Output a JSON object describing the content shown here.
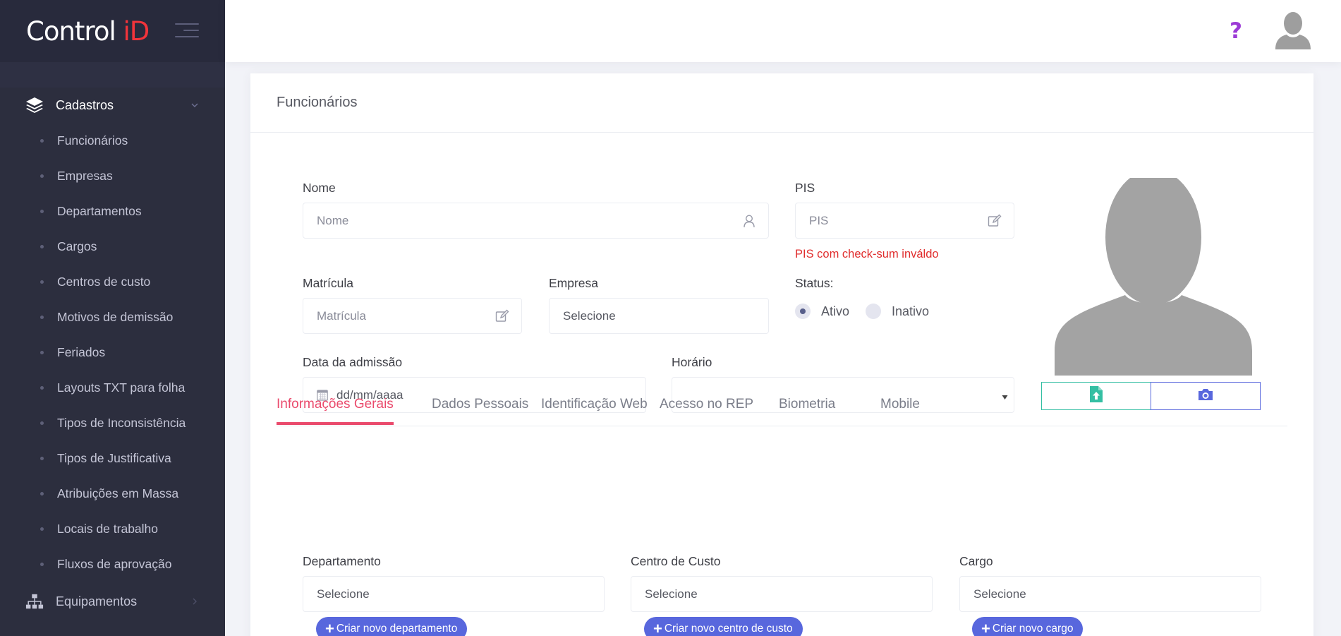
{
  "brand": {
    "name_part1": "Control ",
    "name_part2": "iD"
  },
  "sidebar": {
    "group_main": {
      "label": "Cadastros",
      "icon": "layers-icon"
    },
    "items": [
      {
        "label": "Funcionários"
      },
      {
        "label": "Empresas"
      },
      {
        "label": "Departamentos"
      },
      {
        "label": "Cargos"
      },
      {
        "label": "Centros de custo"
      },
      {
        "label": "Motivos de demissão"
      },
      {
        "label": "Feriados"
      },
      {
        "label": "Layouts TXT para folha"
      },
      {
        "label": "Tipos de Inconsistência"
      },
      {
        "label": "Tipos de Justificativa"
      },
      {
        "label": "Atribuições em Massa"
      },
      {
        "label": "Locais de trabalho"
      },
      {
        "label": "Fluxos de aprovação"
      }
    ],
    "group_equip": {
      "label": "Equipamentos",
      "icon": "sitemap-icon"
    }
  },
  "header": {
    "help": "?",
    "help_color": "#9c3ad6"
  },
  "page": {
    "title": "Funcionários",
    "form": {
      "nome": {
        "label": "Nome",
        "placeholder": "Nome"
      },
      "pis": {
        "label": "PIS",
        "placeholder": "PIS",
        "error": "PIS com check-sum inváldo"
      },
      "matricula": {
        "label": "Matrícula",
        "placeholder": "Matrícula"
      },
      "empresa": {
        "label": "Empresa",
        "placeholder": "Selecione"
      },
      "status": {
        "label": "Status:",
        "options": [
          "Ativo",
          "Inativo"
        ],
        "selected": "Ativo"
      },
      "data_admissao": {
        "label": "Data da admissão",
        "placeholder": "dd/mm/aaaa"
      },
      "horario": {
        "label": "Horário",
        "value": ""
      }
    },
    "tabs": [
      {
        "label": "Informações Gerais",
        "active": true
      },
      {
        "label": "Dados Pessoais",
        "active": false
      },
      {
        "label": "Identificação Web",
        "active": false
      },
      {
        "label": "Acesso no REP",
        "active": false
      },
      {
        "label": "Biometria",
        "active": false
      },
      {
        "label": "Mobile",
        "active": false
      }
    ],
    "general": {
      "departamento": {
        "label": "Departamento",
        "placeholder": "Selecione",
        "create": "Criar novo departamento"
      },
      "centro_custo": {
        "label": "Centro de Custo",
        "placeholder": "Selecione",
        "create": "Criar novo centro de custo"
      },
      "cargo": {
        "label": "Cargo",
        "placeholder": "Selecione",
        "create": "Criar novo cargo"
      }
    }
  },
  "colors": {
    "accent": "#ea4a6c",
    "primary": "#5867dd",
    "success": "#34bfa3",
    "sidebar": "#2c2e3e"
  }
}
